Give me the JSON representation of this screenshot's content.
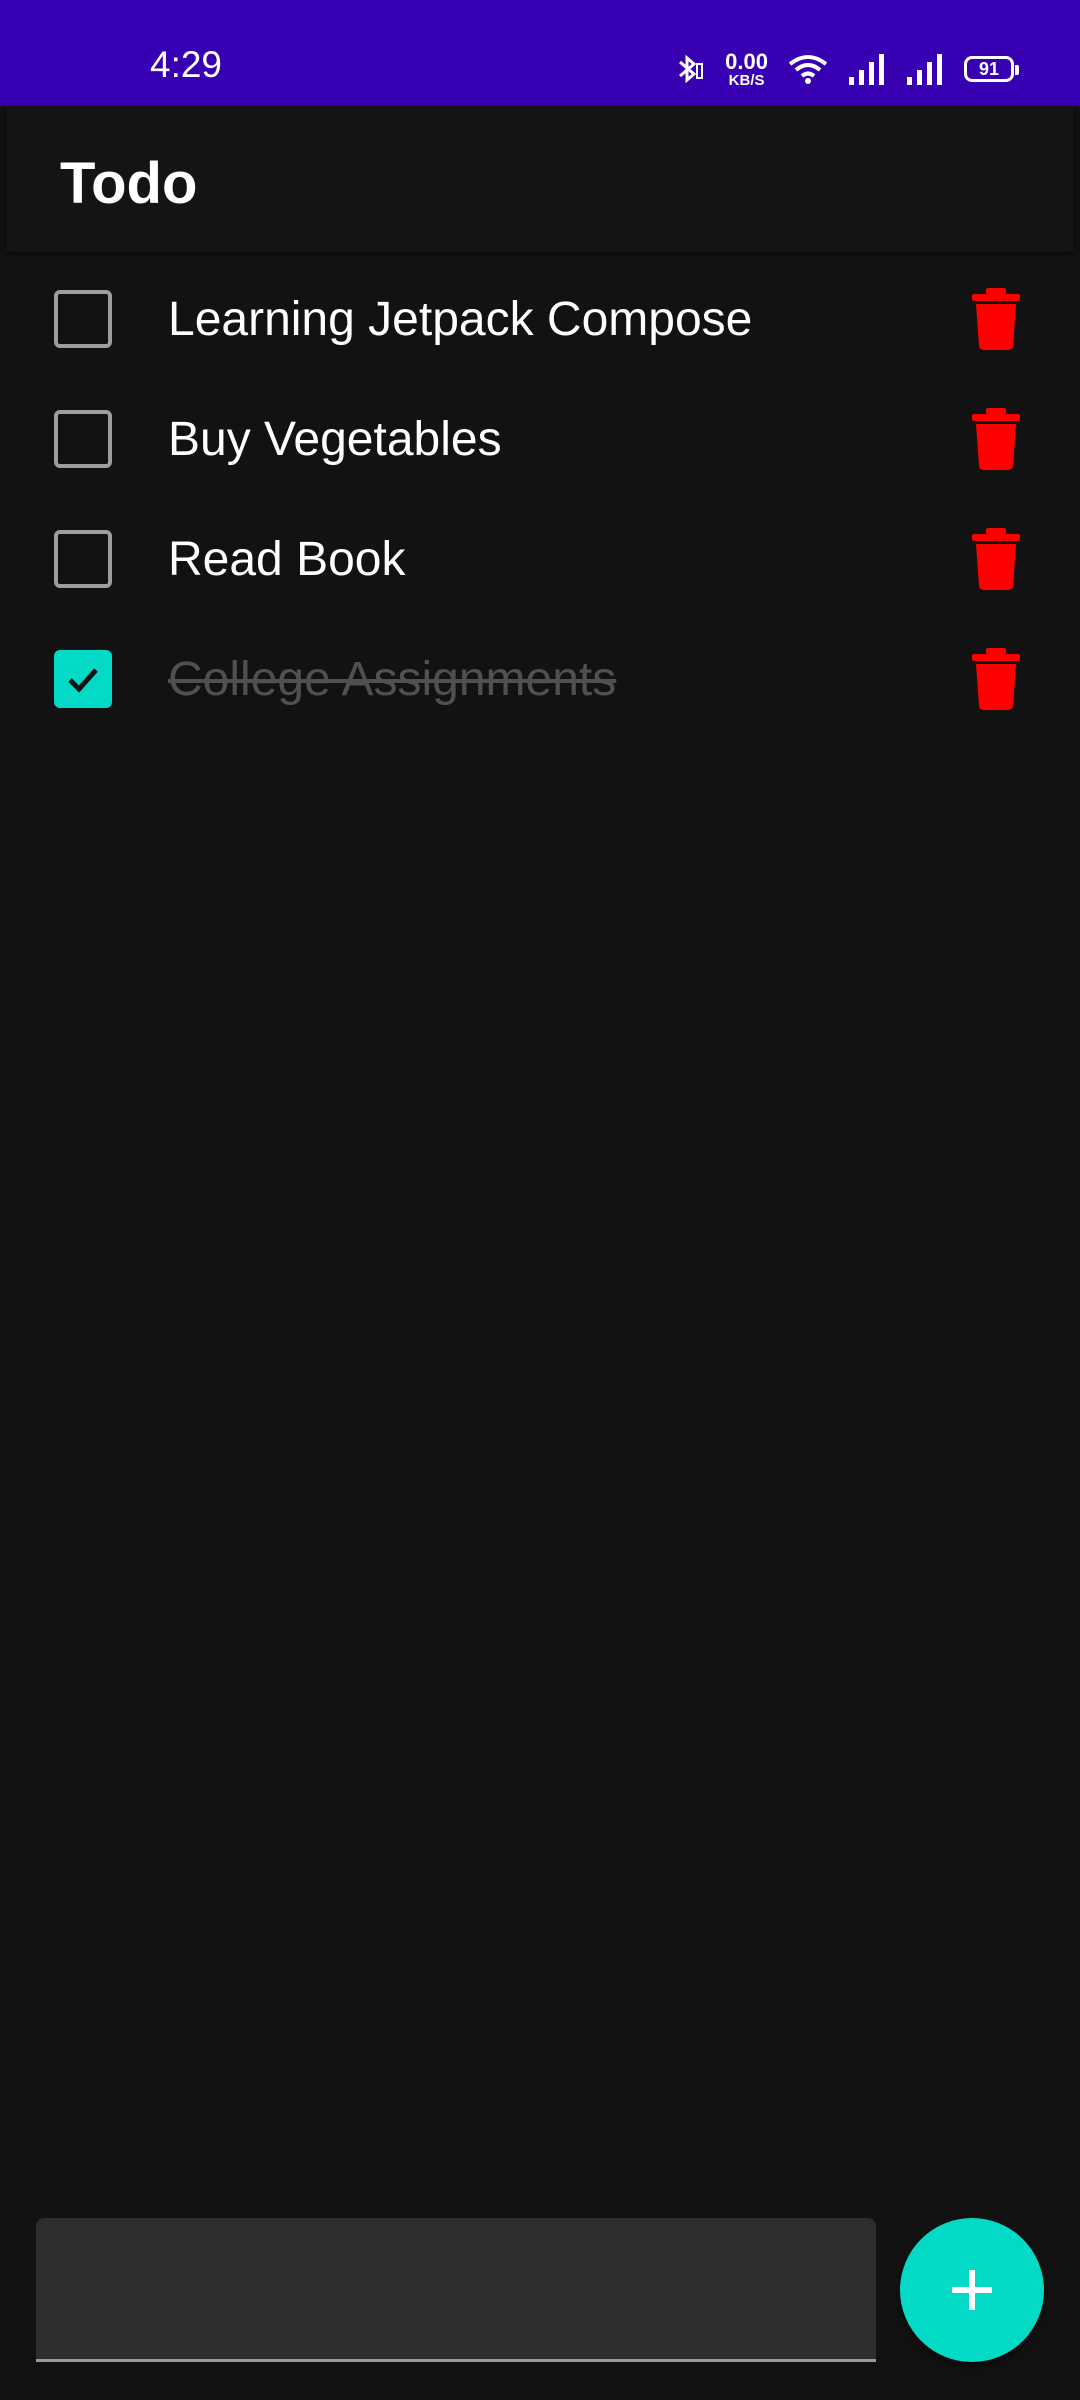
{
  "status_bar": {
    "time": "4:29",
    "net_speed_value": "0.00",
    "net_speed_unit": "KB/S",
    "battery": "91",
    "icons": [
      "bluetooth-icon",
      "wifi-icon",
      "signal-icon",
      "signal-icon",
      "battery-icon"
    ],
    "background": "#3700B3"
  },
  "app_bar": {
    "title": "Todo"
  },
  "todos": [
    {
      "label": "Learning Jetpack Compose",
      "checked": false
    },
    {
      "label": "Buy Vegetables",
      "checked": false
    },
    {
      "label": "Read Book",
      "checked": false
    },
    {
      "label": "College Assignments",
      "checked": true
    }
  ],
  "input": {
    "value": "",
    "placeholder": ""
  },
  "fab": {
    "icon": "plus-icon"
  },
  "colors": {
    "accent": "#03DAC5",
    "delete": "#FF0000",
    "background": "#121212"
  }
}
